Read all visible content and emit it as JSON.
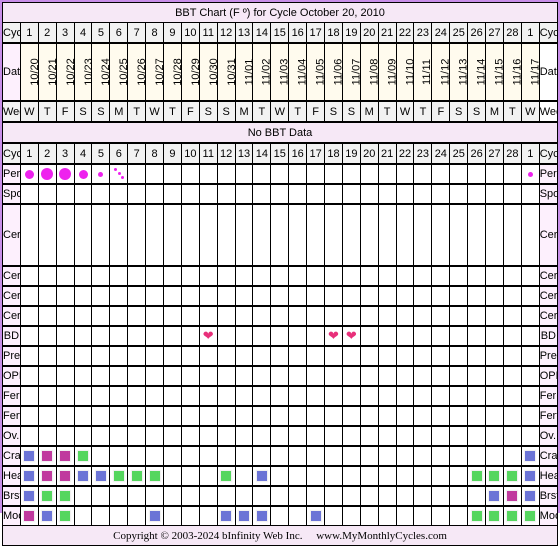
{
  "title": "BBT Chart (F º) for Cycle October 20, 2010",
  "no_bbt_text": "No BBT Data",
  "labels": {
    "cycle_day": "Cycle Day",
    "date": "Date",
    "weekday": "WeekDay"
  },
  "cycle_days": [
    "1",
    "2",
    "3",
    "4",
    "5",
    "6",
    "7",
    "8",
    "9",
    "10",
    "11",
    "12",
    "13",
    "14",
    "15",
    "16",
    "17",
    "18",
    "19",
    "20",
    "21",
    "22",
    "23",
    "24",
    "25",
    "26",
    "27",
    "28",
    "1"
  ],
  "dates": [
    "10/20",
    "10/21",
    "10/22",
    "10/23",
    "10/24",
    "10/25",
    "10/26",
    "10/27",
    "10/28",
    "10/29",
    "10/30",
    "10/31",
    "11/01",
    "11/02",
    "11/03",
    "11/04",
    "11/05",
    "11/06",
    "11/07",
    "11/08",
    "11/09",
    "11/10",
    "11/11",
    "11/12",
    "11/13",
    "11/14",
    "11/15",
    "11/16",
    "11/17"
  ],
  "weekdays": [
    "W",
    "T",
    "F",
    "S",
    "S",
    "M",
    "T",
    "W",
    "T",
    "F",
    "S",
    "S",
    "M",
    "T",
    "W",
    "T",
    "F",
    "S",
    "S",
    "M",
    "T",
    "W",
    "T",
    "F",
    "S",
    "S",
    "M",
    "T",
    "W"
  ],
  "colors": {
    "period": "#ee22ee",
    "heart": "#e8307a",
    "blue": "#6b74d6",
    "magenta": "#c03a9e",
    "green": "#55d65e",
    "border": "#c88ee8"
  },
  "rows": [
    {
      "label": "Period",
      "type": "period",
      "marks": {
        "1": "medium",
        "2": "heavy",
        "3": "heavy",
        "4": "medium",
        "5": "light",
        "6": "spotting",
        "29": "light"
      }
    },
    {
      "label": "Spotting",
      "type": "plain",
      "marks": {}
    },
    {
      "label": "Cerv Fluid",
      "type": "tall",
      "marks": {}
    },
    {
      "label": "Cerv Pos",
      "type": "plain",
      "marks": {}
    },
    {
      "label": "Cerv Firm",
      "type": "plain",
      "marks": {}
    },
    {
      "label": "Cerv Opn",
      "type": "plain",
      "marks": {}
    },
    {
      "label": "BD",
      "type": "heart",
      "marks": {
        "11": "heart",
        "18": "heart",
        "19": "heart"
      }
    },
    {
      "label": "Preg Test",
      "type": "plain",
      "marks": {}
    },
    {
      "label": "OPK",
      "type": "plain",
      "marks": {}
    },
    {
      "label": "Ferning",
      "type": "plain",
      "marks": {}
    },
    {
      "label": "FertMon",
      "type": "plain",
      "marks": {}
    },
    {
      "label": "Ov. Pain",
      "type": "plain",
      "marks": {}
    },
    {
      "label": "Cramps",
      "type": "square",
      "marks": {
        "1": "blue",
        "2": "magenta",
        "3": "magenta",
        "4": "green",
        "29": "blue"
      }
    },
    {
      "label": "Headache",
      "type": "square",
      "marks": {
        "1": "blue",
        "2": "magenta",
        "3": "magenta",
        "4": "blue",
        "5": "blue",
        "6": "green",
        "7": "green",
        "8": "green",
        "12": "green",
        "14": "blue",
        "26": "green",
        "27": "green",
        "28": "green",
        "29": "blue"
      }
    },
    {
      "label": "Brst. Tend.",
      "type": "square",
      "marks": {
        "1": "blue",
        "2": "green",
        "3": "green",
        "27": "blue",
        "28": "magenta",
        "29": "blue"
      }
    },
    {
      "label": "Moody",
      "type": "square",
      "marks": {
        "1": "magenta",
        "2": "blue",
        "3": "green",
        "8": "blue",
        "12": "blue",
        "13": "blue",
        "14": "blue",
        "17": "blue",
        "26": "green",
        "27": "green",
        "28": "green",
        "29": "green"
      }
    }
  ],
  "footer": {
    "copyright": "Copyright © 2003-2024 bInfinity Web Inc.",
    "website": "www.MyMonthlyCycles.com"
  }
}
